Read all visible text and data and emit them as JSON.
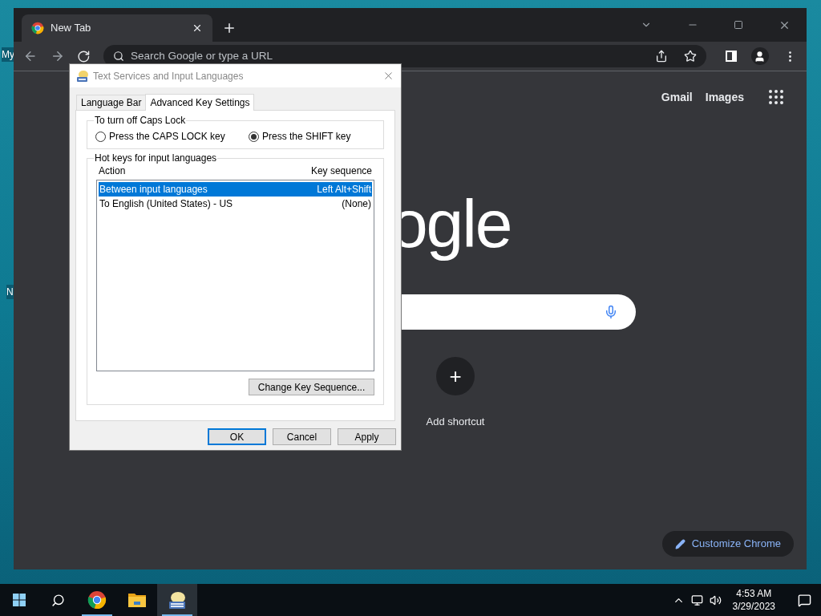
{
  "desktop": {
    "icon_labels": [
      "My",
      "N"
    ]
  },
  "browser": {
    "tabs": [
      {
        "title": "New Tab",
        "selected": true
      }
    ],
    "omnibox": {
      "placeholder": "Search Google or type a URL"
    },
    "header_links": [
      "Gmail",
      "Images"
    ],
    "logo_visible_text": "ogle",
    "shortcut": {
      "label": "Add shortcut",
      "icon": "+"
    },
    "customize_button": "Customize Chrome"
  },
  "dialog": {
    "title": "Text Services and Input Languages",
    "tabs": [
      {
        "label": "Language Bar",
        "selected": false
      },
      {
        "label": "Advanced Key Settings",
        "selected": true
      }
    ],
    "caps_lock_group": {
      "title": "To turn off Caps Lock",
      "options": [
        {
          "label": "Press the CAPS LOCK key",
          "selected": false
        },
        {
          "label": "Press the SHIFT key",
          "selected": true
        }
      ]
    },
    "hotkeys_group": {
      "title": "Hot keys for input languages",
      "columns": [
        "Action",
        "Key sequence"
      ],
      "rows": [
        {
          "action": "Between input languages",
          "key_sequence": "Left Alt+Shift",
          "selected": true
        },
        {
          "action": "To English (United States) - US",
          "key_sequence": "(None)",
          "selected": false
        }
      ],
      "button": "Change Key Sequence..."
    },
    "buttons": [
      {
        "label": "OK",
        "default": true
      },
      {
        "label": "Cancel",
        "default": false
      },
      {
        "label": "Apply",
        "default": false
      }
    ]
  },
  "taskbar": {
    "apps": [
      {
        "kind": "chrome",
        "running": true,
        "active": false
      },
      {
        "kind": "folder",
        "running": false,
        "active": false
      },
      {
        "kind": "keyboard",
        "running": true,
        "active": true
      }
    ],
    "time": "4:53 AM",
    "date": "3/29/2023"
  }
}
